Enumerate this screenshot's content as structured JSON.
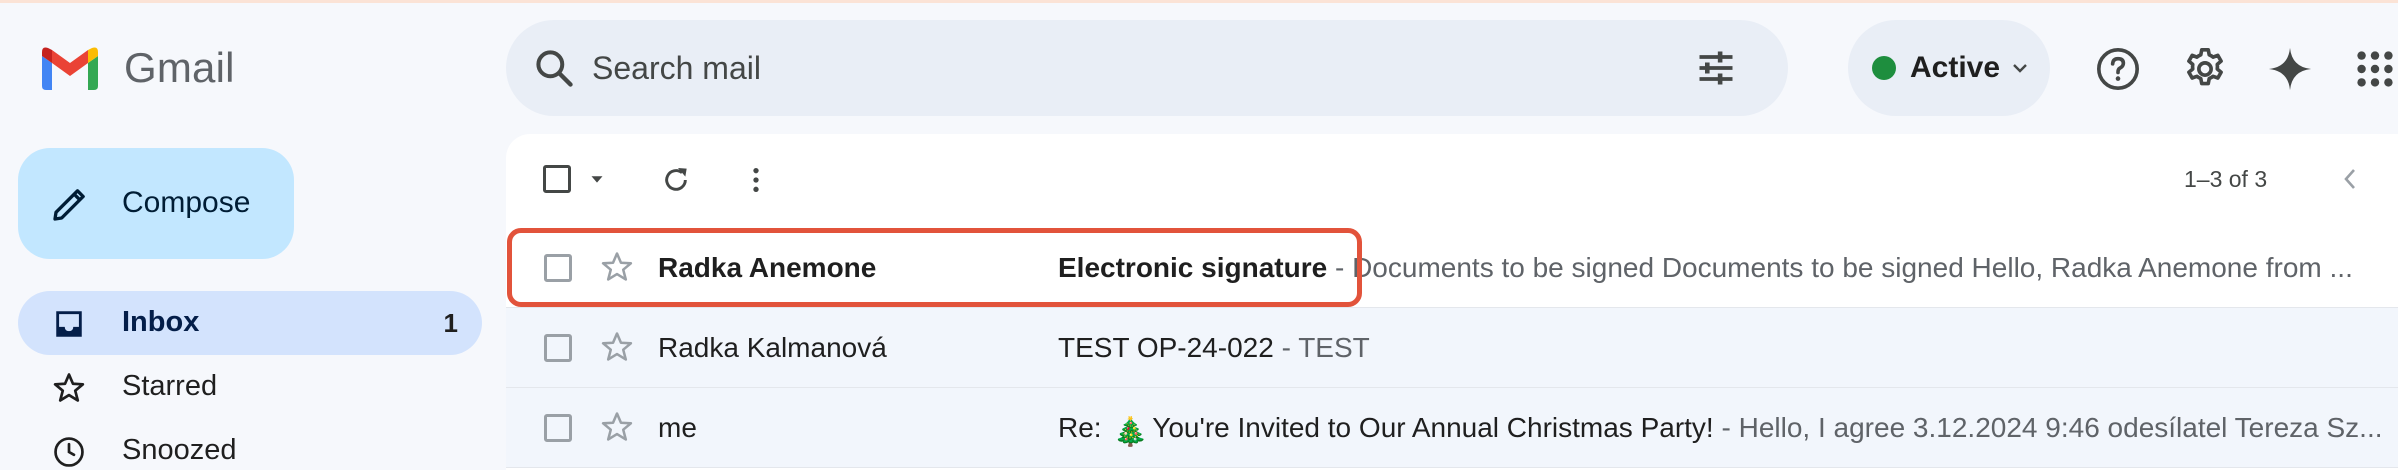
{
  "app": {
    "name": "Gmail"
  },
  "search": {
    "placeholder": "Search mail"
  },
  "status": {
    "label": "Active",
    "color": "#1e8e3e"
  },
  "header_icons": [
    "help-icon",
    "settings-icon",
    "gemini-icon",
    "apps-icon"
  ],
  "compose": {
    "label": "Compose"
  },
  "sidebar": {
    "items": [
      {
        "label": "Inbox",
        "count": "1",
        "icon": "inbox-icon",
        "selected": true
      },
      {
        "label": "Starred",
        "icon": "star-icon"
      },
      {
        "label": "Snoozed",
        "icon": "clock-icon"
      }
    ]
  },
  "toolbar": {
    "pagination": "1–3 of 3"
  },
  "emails": [
    {
      "sender": "Radka Anemone",
      "subject": "Electronic signature",
      "separator": " - ",
      "snippet": "Documents to be signed Documents to be signed Hello, Radka Anemone from ...",
      "unread": true,
      "highlighted": true
    },
    {
      "sender": "Radka Kalmanová",
      "subject": "TEST OP-24-022",
      "separator": " - ",
      "snippet": "TEST",
      "unread": false
    },
    {
      "sender": "me",
      "subject_prefix": "Re: ",
      "subject_emoji": "🎄",
      "subject": "You're Invited to Our Annual Christmas Party!",
      "separator": " - ",
      "snippet": "Hello, I agree 3.12.2024 9:46 odesílatel Tereza Sz...",
      "unread": false
    }
  ],
  "colors": {
    "accent_highlight": "#e2533b",
    "compose_bg": "#c2e7ff",
    "selected_nav": "#d3e3fd"
  }
}
